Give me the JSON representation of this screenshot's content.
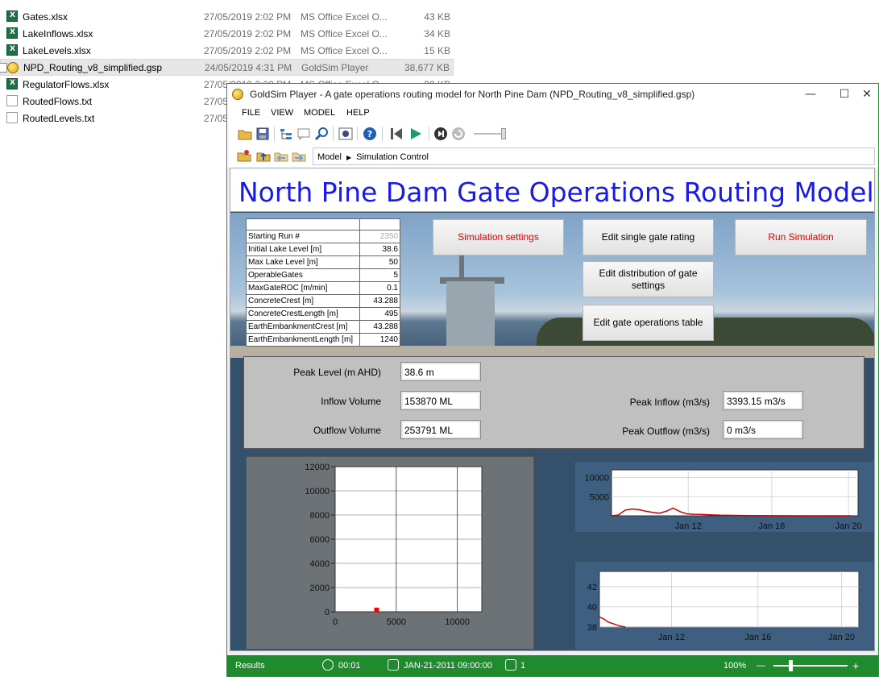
{
  "files": [
    {
      "name": "Gates.xlsx",
      "date": "27/05/2019 2:02 PM",
      "type": "MS Office Excel O...",
      "size": "43 KB",
      "kind": "xls"
    },
    {
      "name": "LakeInflows.xlsx",
      "date": "27/05/2019 2:02 PM",
      "type": "MS Office Excel O...",
      "size": "34 KB",
      "kind": "xls"
    },
    {
      "name": "LakeLevels.xlsx",
      "date": "27/05/2019 2:02 PM",
      "type": "MS Office Excel O...",
      "size": "15 KB",
      "kind": "xls"
    },
    {
      "name": "NPD_Routing_v8_simplified.gsp",
      "date": "24/05/2019 4:31 PM",
      "type": "GoldSim Player",
      "size": "38,677 KB",
      "kind": "gsp"
    },
    {
      "name": "RegulatorFlows.xlsx",
      "date": "27/05/2019 2:02 PM",
      "type": "MS Office Excel O...",
      "size": "30 KB",
      "kind": "xls"
    },
    {
      "name": "RoutedFlows.txt",
      "date": "27/05",
      "type": "",
      "size": "",
      "kind": "txt"
    },
    {
      "name": "RoutedLevels.txt",
      "date": "27/05",
      "type": "",
      "size": "",
      "kind": "txt"
    }
  ],
  "window": {
    "title": "GoldSim Player - A gate operations routing model for North Pine Dam (NPD_Routing_v8_simplified.gsp)",
    "minimize": "—",
    "maximize": "☐",
    "close": "✕"
  },
  "menu": {
    "file": "FILE",
    "view": "VIEW",
    "model": "MODEL",
    "help": "HELP"
  },
  "breadcrumb": {
    "root": "Model",
    "current": "Simulation Control"
  },
  "main": {
    "title": "North Pine Dam Gate Operations Routing Model",
    "params": [
      {
        "label": "Starting Run #",
        "value": "2350"
      },
      {
        "label": "Initial Lake Level [m]",
        "value": "38.6"
      },
      {
        "label": "Max Lake Level [m]",
        "value": "50"
      },
      {
        "label": "OperableGates",
        "value": "5"
      },
      {
        "label": "MaxGateROC [m/min]",
        "value": "0.1"
      },
      {
        "label": "ConcreteCrest [m]",
        "value": "43.288"
      },
      {
        "label": "ConcreteCrestLength [m]",
        "value": "495"
      },
      {
        "label": "EarthEmbankmentCrest [m]",
        "value": "43.288"
      },
      {
        "label": "EarthEmbankmentLength [m]",
        "value": "1240"
      }
    ],
    "buttons": {
      "sim_settings": "Simulation settings",
      "edit_rating": "Edit single gate rating",
      "run": "Run Simulation",
      "edit_distribution": "Edit distribution of gate settings",
      "edit_table": "Edit gate operations table"
    },
    "results": {
      "peak_level_label": "Peak Level (m AHD)",
      "peak_level": "38.6 m",
      "inflow_volume_label": "Inflow Volume",
      "inflow_volume": "153870 ML",
      "outflow_volume_label": "Outflow Volume",
      "outflow_volume": "253791 ML",
      "peak_inflow_label": "Peak Inflow (m3/s)",
      "peak_inflow": "3393.15 m3/s",
      "peak_outflow_label": "Peak Outflow (m3/s)",
      "peak_outflow": "0 m3/s"
    }
  },
  "chart_data": [
    {
      "type": "scatter",
      "title": "",
      "x_ticks": [
        "0",
        "5000",
        "10000"
      ],
      "y_ticks": [
        "0",
        "2000",
        "4000",
        "6000",
        "8000",
        "10000",
        "12000"
      ],
      "xlim": [
        0,
        12000
      ],
      "ylim": [
        0,
        12000
      ],
      "grid": true,
      "points": [
        {
          "x": 3393,
          "y": 0
        }
      ],
      "marker_color": "#ff0000"
    },
    {
      "type": "line",
      "title": "",
      "x_ticks": [
        "Jan 12",
        "Jan 16",
        "Jan 20"
      ],
      "y_ticks": [
        "5000",
        "10000"
      ],
      "ylim": [
        0,
        12000
      ],
      "grid": true,
      "series_color": "#cc0000",
      "x": [
        0,
        0.5,
        1,
        1.5,
        2,
        2.5,
        3,
        3.5,
        4,
        4.5,
        5,
        5.5,
        6,
        6.5,
        7,
        8,
        10,
        12,
        14,
        16,
        17.5
      ],
      "y": [
        0,
        200,
        1500,
        1800,
        1600,
        1200,
        900,
        700,
        1200,
        2000,
        1100,
        500,
        400,
        350,
        300,
        150,
        50,
        20,
        10,
        5,
        0
      ]
    },
    {
      "type": "line",
      "title": "",
      "x_ticks": [
        "Jan 12",
        "Jan 16",
        "Jan 20"
      ],
      "y_ticks": [
        "38",
        "40",
        "42"
      ],
      "ylim": [
        38,
        43.5
      ],
      "grid": true,
      "series_color": "#cc0000",
      "x": [
        0,
        0.3,
        0.6,
        1,
        1.4,
        1.8
      ],
      "y": [
        39.0,
        38.8,
        38.5,
        38.3,
        38.1,
        38.0
      ]
    }
  ],
  "status": {
    "results": "Results",
    "time": "00:01",
    "date": "JAN-21-2011 09:00:00",
    "realization": "1",
    "zoom": "100%",
    "zoom_out": "—",
    "zoom_in": "+"
  }
}
